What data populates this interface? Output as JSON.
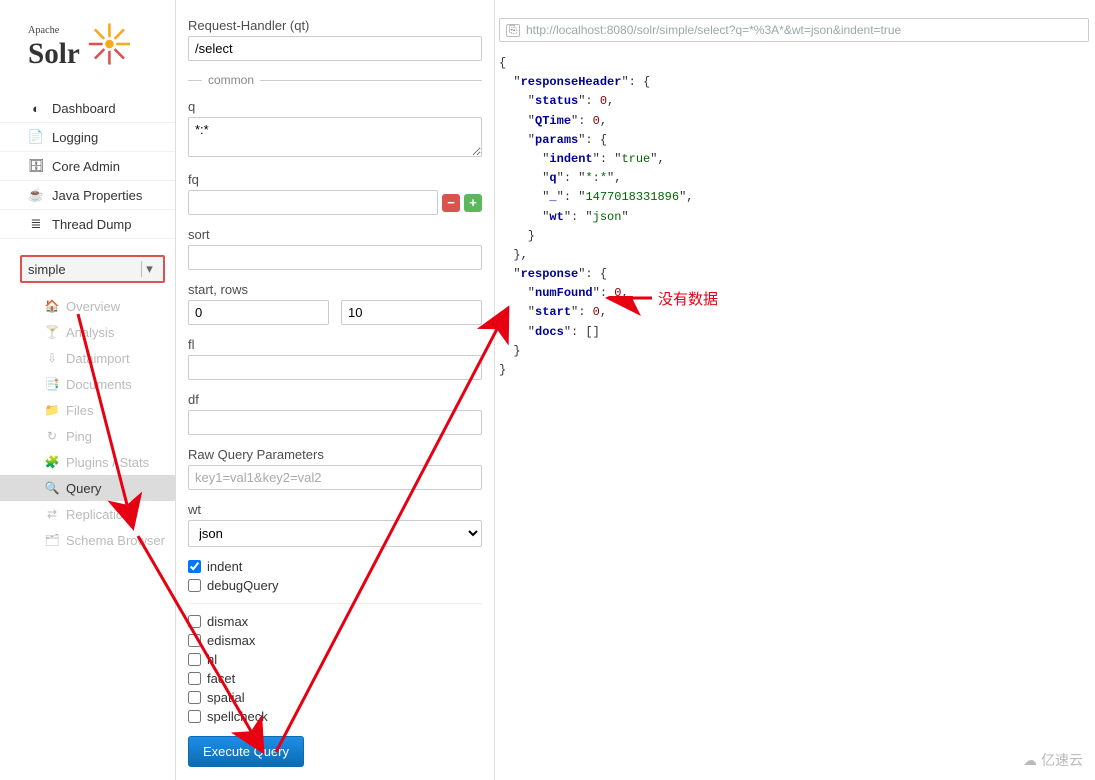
{
  "logo": {
    "brand_top": "Apache",
    "brand_main": "Solr"
  },
  "nav": {
    "items": [
      {
        "label": "Dashboard",
        "icon": "●"
      },
      {
        "label": "Logging",
        "icon": "📄"
      },
      {
        "label": "Core Admin",
        "icon": "🗄"
      },
      {
        "label": "Java Properties",
        "icon": "☕"
      },
      {
        "label": "Thread Dump",
        "icon": "≡"
      }
    ]
  },
  "core_select": {
    "value": "simple"
  },
  "subnav": {
    "items": [
      {
        "label": "Overview",
        "icon": "🏠"
      },
      {
        "label": "Analysis",
        "icon": "🍸"
      },
      {
        "label": "Dataimport",
        "icon": "⇩"
      },
      {
        "label": "Documents",
        "icon": "📑"
      },
      {
        "label": "Files",
        "icon": "📁"
      },
      {
        "label": "Ping",
        "icon": "↻"
      },
      {
        "label": "Plugins / Stats",
        "icon": "🧩"
      },
      {
        "label": "Query",
        "icon": "🔍",
        "active": true
      },
      {
        "label": "Replication",
        "icon": "⇄"
      },
      {
        "label": "Schema Browser",
        "icon": "🗂"
      }
    ]
  },
  "form": {
    "request_handler_label": "Request-Handler (qt)",
    "request_handler_value": "/select",
    "common_label": "common",
    "q_label": "q",
    "q_value": "*:*",
    "fq_label": "fq",
    "fq_value": "",
    "sort_label": "sort",
    "sort_value": "",
    "start_rows_label": "start, rows",
    "start_value": "0",
    "rows_value": "10",
    "fl_label": "fl",
    "fl_value": "",
    "df_label": "df",
    "df_value": "",
    "raw_label": "Raw Query Parameters",
    "raw_placeholder": "key1=val1&key2=val2",
    "wt_label": "wt",
    "wt_value": "json",
    "indent_label": "indent",
    "debug_label": "debugQuery",
    "dismax_label": "dismax",
    "edismax_label": "edismax",
    "hl_label": "hl",
    "facet_label": "facet",
    "spatial_label": "spatial",
    "spellcheck_label": "spellcheck",
    "execute_label": "Execute Query"
  },
  "result": {
    "url": "http://localhost:8080/solr/simple/select?q=*%3A*&wt=json&indent=true",
    "json_values": {
      "status": 0,
      "QTime": 0,
      "indent": "true",
      "q": "*:*",
      "underscore": "1477018331896",
      "wt": "json",
      "numFound": 0,
      "start": 0
    }
  },
  "annotation": {
    "text": "没有数据"
  },
  "watermark": {
    "text": "亿速云"
  }
}
